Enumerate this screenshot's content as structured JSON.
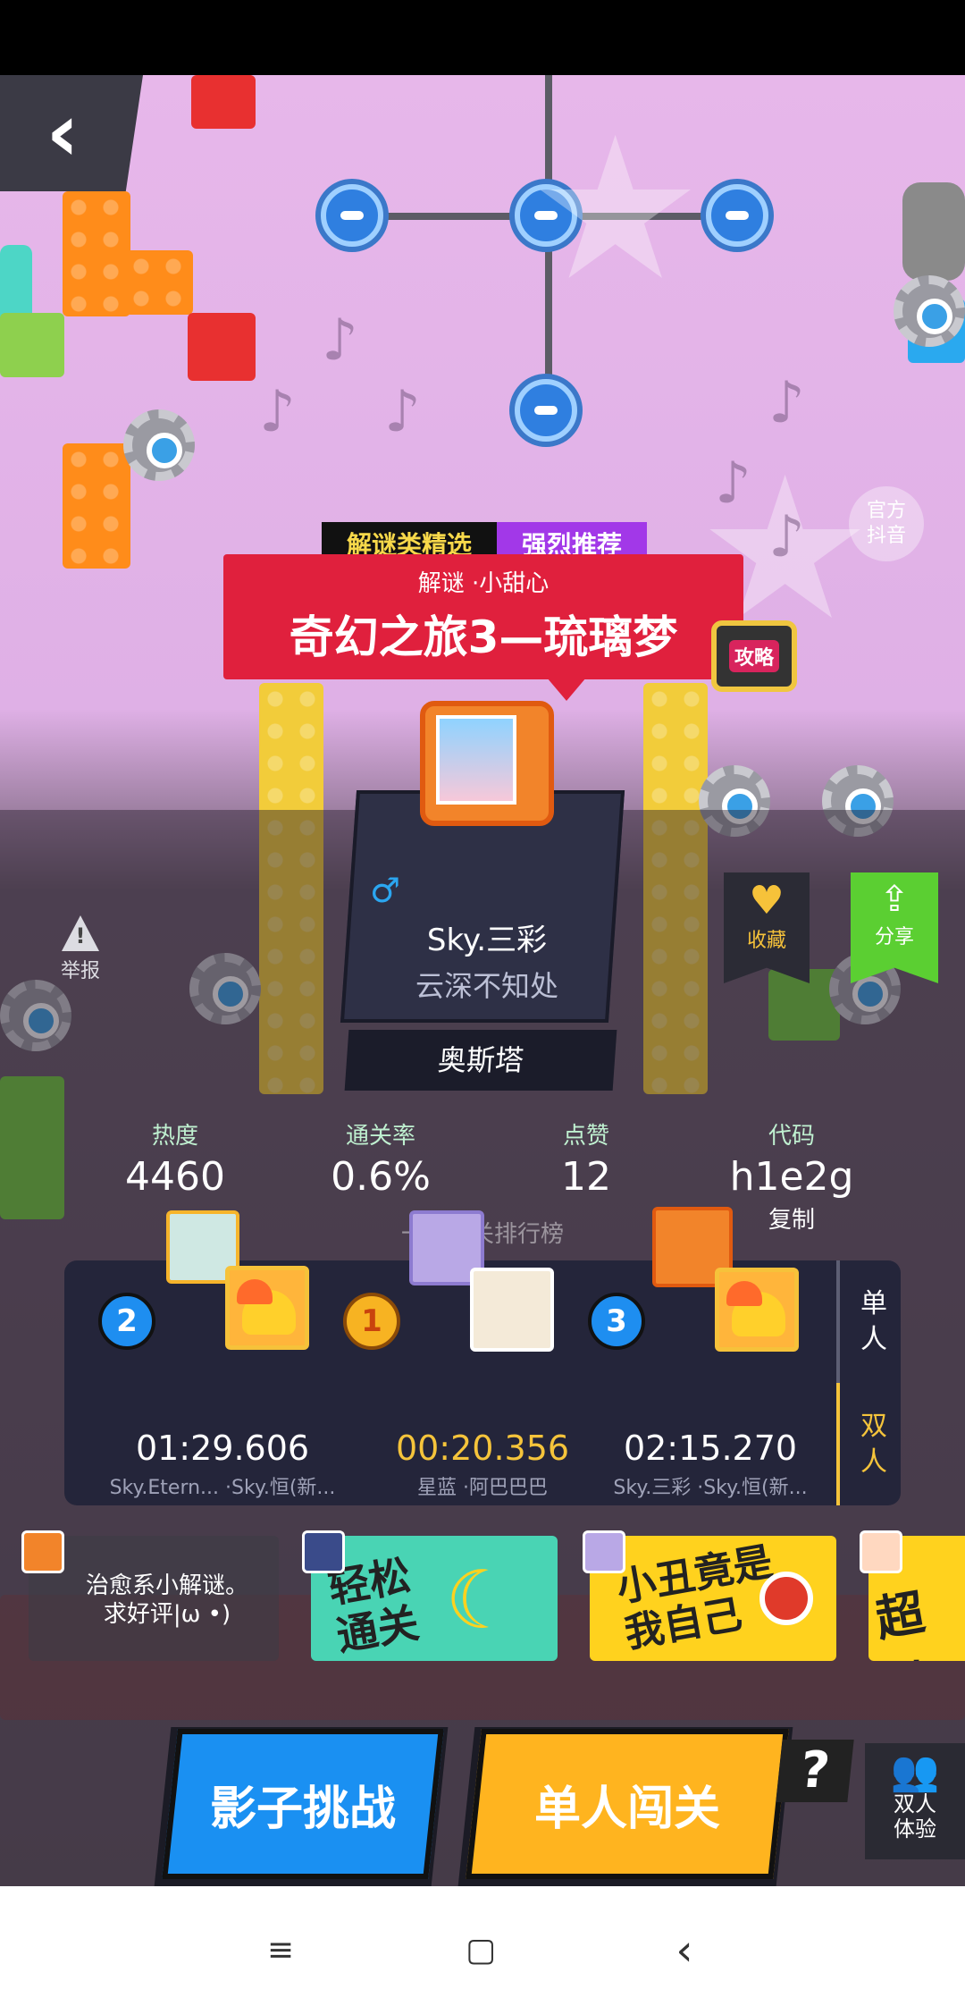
{
  "game": {
    "back_label": "‹",
    "official_douyin": "官方\n抖音",
    "tags": {
      "category": "解谜类精选",
      "recommend": "强烈推荐"
    },
    "level": {
      "author_line": "解谜 ·小甜心",
      "title": "奇幻之旅3—琉璃梦"
    },
    "guide_label": "攻略",
    "author": {
      "gender_icon": "♂",
      "name": "Sky.三彩",
      "subtitle": "云深不知处",
      "place": "奥斯塔"
    },
    "report_label": "举报",
    "favorite_label": "收藏",
    "share_label": "分享",
    "stats": [
      {
        "label": "热度",
        "value": "4460"
      },
      {
        "label": "通关率",
        "value": "0.6%"
      },
      {
        "label": "点赞",
        "value": "12"
      },
      {
        "label": "代码",
        "value": "h1e2g"
      }
    ],
    "copy_label": "复制",
    "rank_title": "一命通关排行榜",
    "leaderboard": {
      "tabs": [
        "单\n人",
        "双\n人"
      ],
      "active_tab": "双人",
      "entries": [
        {
          "rank": "2",
          "time": "01:29.606",
          "names": "Sky.Etern... ·Sky.恒(新..."
        },
        {
          "rank": "1",
          "time": "00:20.356",
          "names": "星蓝 ·阿巴巴巴"
        },
        {
          "rank": "3",
          "time": "02:15.270",
          "names": "Sky.三彩 ·Sky.恒(新..."
        }
      ]
    },
    "recommendations": [
      {
        "label": "治愈系小解谜。\n求好评|ω •)"
      },
      {
        "label": "轻松\n通关"
      },
      {
        "label": "小丑竟是\n我自己"
      },
      {
        "label": "超棒"
      }
    ],
    "buttons": {
      "shadow_challenge": "影子挑战",
      "solo_play": "单人闯关",
      "help": "?",
      "duo_trial": "双人\n体验"
    }
  },
  "navbar": {
    "menu_icon": "≡",
    "home_icon": "▢",
    "back_icon": "‹"
  },
  "colors": {
    "accent_red": "#e0203d",
    "accent_blue": "#1a90f2",
    "accent_yellow": "#ffb41f",
    "share_green": "#5bcf32"
  }
}
